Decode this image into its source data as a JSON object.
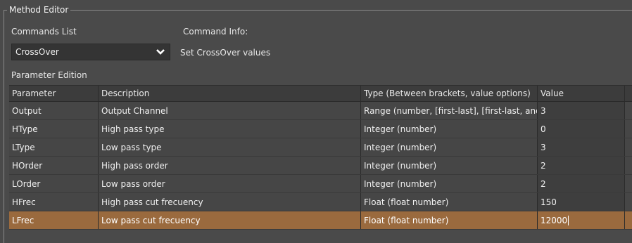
{
  "editor": {
    "title": "Method Editor",
    "commands_list_label": "Commands List",
    "command_info_label": "Command Info:",
    "selected_command": "CrossOver",
    "command_info_text": "Set CrossOver values",
    "parameter_edition_label": "Parameter Edition"
  },
  "table": {
    "columns": [
      "Parameter",
      "Description",
      "Type (Between brackets, value options)",
      "Value"
    ],
    "rows": [
      {
        "parameter": "Output",
        "description": "Output Channel",
        "type": "Range (number, [first-last], [first-last, and",
        "value": "3"
      },
      {
        "parameter": "HType",
        "description": "High pass type",
        "type": "Integer (number)",
        "value": "0"
      },
      {
        "parameter": "LType",
        "description": " Low pass type",
        "type": "Integer (number)",
        "value": "3"
      },
      {
        "parameter": "HOrder",
        "description": " High pass order",
        "type": "Integer (number)",
        "value": "2"
      },
      {
        "parameter": "LOrder",
        "description": " Low pass order",
        "type": "Integer (number)",
        "value": "2"
      },
      {
        "parameter": "HFrec",
        "description": " High pass cut frecuency",
        "type": "Float (float number)",
        "value": "150"
      },
      {
        "parameter": "LFrec",
        "description": " Low pass cut frecuency",
        "type": "Float (float number)",
        "value": "12000"
      }
    ],
    "selected_row_color": "#9a6a3e"
  },
  "icons": {
    "dropdown": "chevron-down-icon"
  }
}
